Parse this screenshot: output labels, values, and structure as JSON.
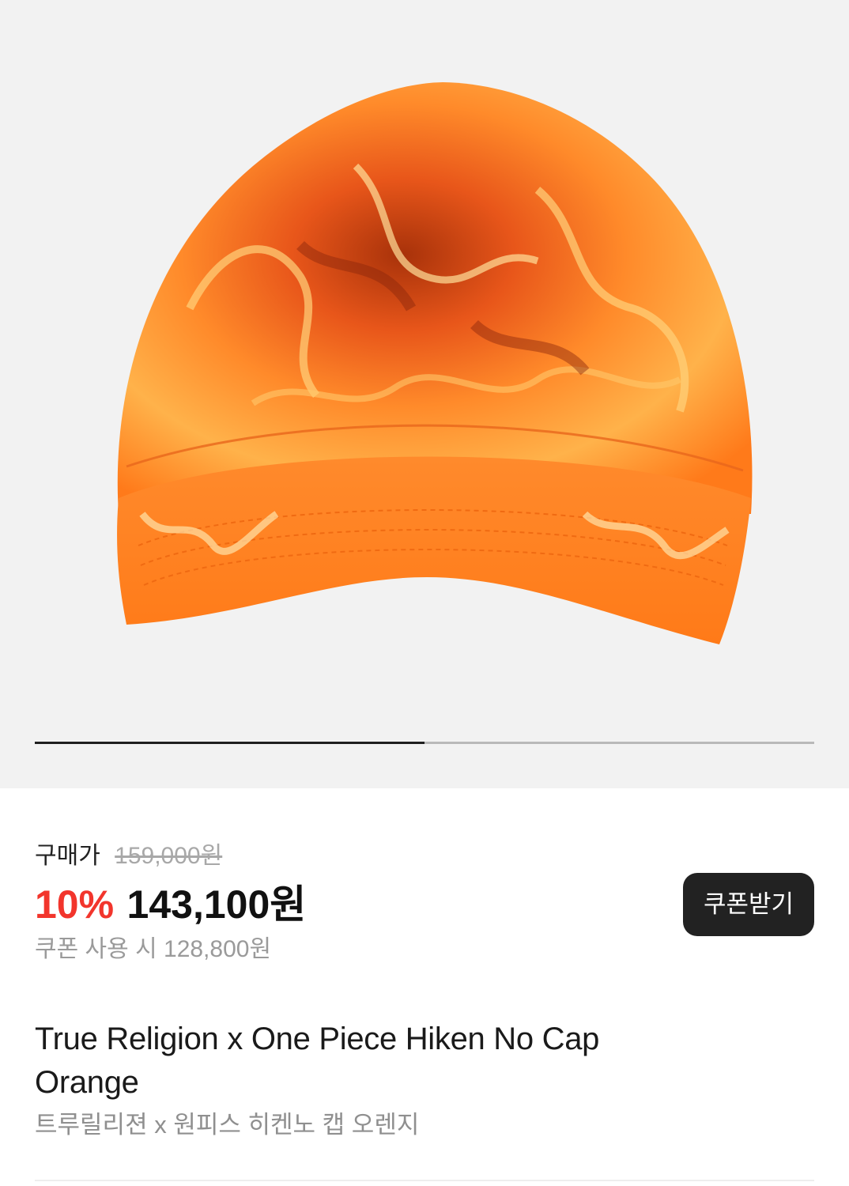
{
  "gallery": {
    "image_icon": "flame-print-cap-image",
    "progress_fraction": 0.5,
    "colors": {
      "background": "#f2f2f2",
      "progress_active": "#1f1f1f",
      "progress_track": "#b9b9b9"
    }
  },
  "price": {
    "label": "구매가",
    "original_price": "159,000원",
    "discount_rate": "10%",
    "sale_price": "143,100원",
    "coupon_price_text": "쿠폰 사용 시 128,800원",
    "coupon_button_label": "쿠폰받기",
    "colors": {
      "discount": "#f2352c",
      "button_bg": "#222222"
    }
  },
  "product": {
    "title": "True Religion x One Piece Hiken No Cap Orange",
    "subtitle": "트루릴리젼 x 원피스 히켄노 캡 오렌지"
  }
}
